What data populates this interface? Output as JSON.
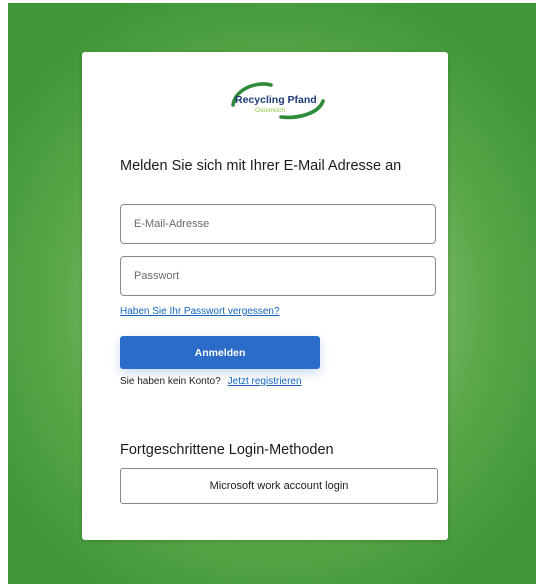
{
  "logo": {
    "brand_line1": "Recycling Pfand",
    "brand_line2": "Österreich",
    "colors": {
      "green": "#2e8b3a",
      "navy": "#1f3b78",
      "lime": "#8cc63f"
    }
  },
  "login": {
    "heading": "Melden Sie sich mit Ihrer E-Mail Adresse an",
    "email_placeholder": "E-Mail-Adresse",
    "email_value": "",
    "password_placeholder": "Passwort",
    "password_value": "",
    "forgot_link": "Haben Sie Ihr Passwort vergessen?",
    "submit_label": "Anmelden",
    "no_account_text": "Sie haben kein Konto?",
    "register_link": "Jetzt registrieren"
  },
  "advanced": {
    "title": "Fortgeschrittene Login-Methoden",
    "microsoft_button": "Microsoft work account login"
  },
  "theme": {
    "background_green": "#4a9e3f",
    "primary_button": "#2a6cc8",
    "link_color": "#1565c0"
  }
}
